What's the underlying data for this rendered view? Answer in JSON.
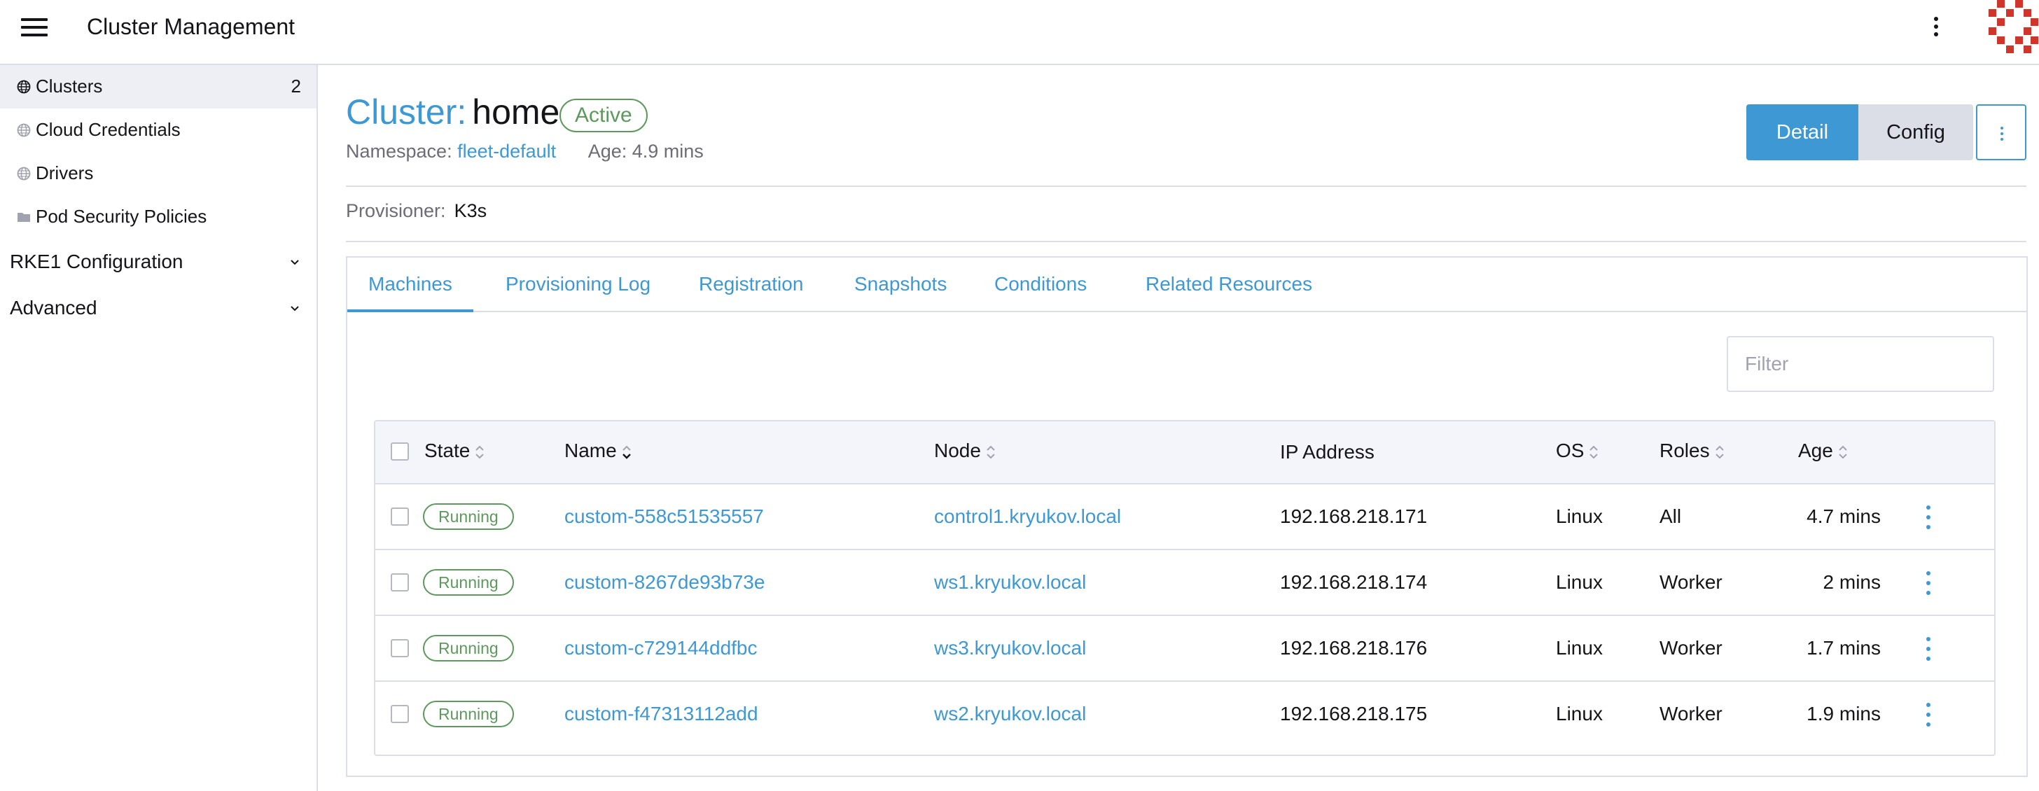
{
  "header": {
    "title": "Cluster Management",
    "menu_icon": "hamburger-menu-icon",
    "more_icon": "vertical-dots-icon",
    "logo_icon": "rancher-logo-icon"
  },
  "sidebar": {
    "items": [
      {
        "label": "Clusters",
        "count": "2",
        "icon": "globe-icon",
        "active": true
      },
      {
        "label": "Cloud Credentials",
        "icon": "globe-icon",
        "active": false
      },
      {
        "label": "Drivers",
        "icon": "globe-icon",
        "active": false
      },
      {
        "label": "Pod Security Policies",
        "icon": "folder-icon",
        "active": false
      }
    ],
    "groups": [
      {
        "label": "RKE1 Configuration",
        "icon": "chevron-down-icon"
      },
      {
        "label": "Advanced",
        "icon": "chevron-down-icon"
      }
    ]
  },
  "cluster": {
    "prefix": "Cluster:",
    "name": "home",
    "status": "Active",
    "namespace_label": "Namespace:",
    "namespace": "fleet-default",
    "age": "Age: 4.9 mins",
    "provisioner_label": "Provisioner:",
    "provisioner": "K3s"
  },
  "actions": {
    "detail": "Detail",
    "config": "Config"
  },
  "tabs": [
    {
      "label": "Machines",
      "active": true
    },
    {
      "label": "Provisioning Log",
      "active": false
    },
    {
      "label": "Registration",
      "active": false
    },
    {
      "label": "Snapshots",
      "active": false
    },
    {
      "label": "Conditions",
      "active": false
    },
    {
      "label": "Related Resources",
      "active": false
    }
  ],
  "filter": {
    "placeholder": "Filter",
    "value": ""
  },
  "table": {
    "columns": [
      "State",
      "Name",
      "Node",
      "IP Address",
      "OS",
      "Roles",
      "Age"
    ],
    "rows": [
      {
        "state": "Running",
        "name": "custom-558c51535557",
        "node": "control1.kryukov.local",
        "ip": "192.168.218.171",
        "os": "Linux",
        "roles": "All",
        "age": "4.7 mins"
      },
      {
        "state": "Running",
        "name": "custom-8267de93b73e",
        "node": "ws1.kryukov.local",
        "ip": "192.168.218.174",
        "os": "Linux",
        "roles": "Worker",
        "age": "2 mins"
      },
      {
        "state": "Running",
        "name": "custom-c729144ddfbc",
        "node": "ws3.kryukov.local",
        "ip": "192.168.218.176",
        "os": "Linux",
        "roles": "Worker",
        "age": "1.7 mins"
      },
      {
        "state": "Running",
        "name": "custom-f47313112add",
        "node": "ws2.kryukov.local",
        "ip": "192.168.218.175",
        "os": "Linux",
        "roles": "Worker",
        "age": "1.9 mins"
      }
    ]
  },
  "colors": {
    "accent": "#3d98d3",
    "success": "#5d995d",
    "border": "#dcdee7",
    "logo": "#d0352b"
  }
}
